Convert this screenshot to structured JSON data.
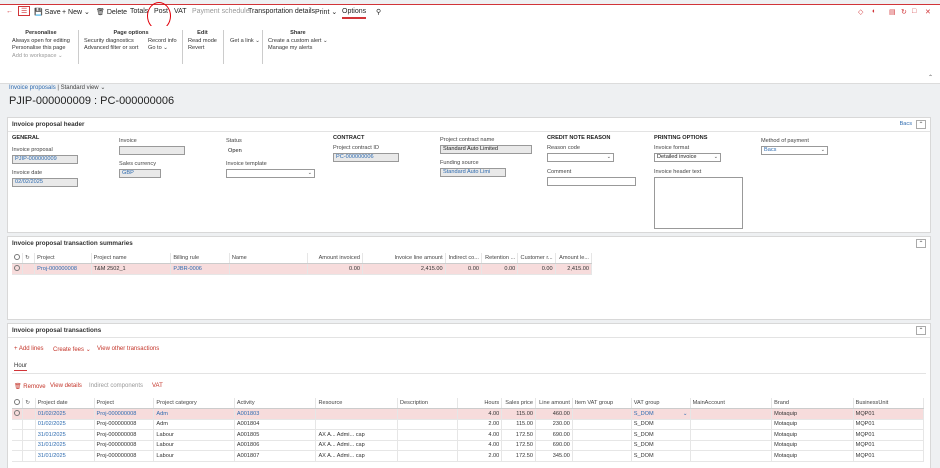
{
  "actionbar": {
    "save": "Save",
    "new": "New",
    "delete": "Delete",
    "totals": "Totals",
    "post": "Post",
    "vat": "VAT",
    "payment_schedule": "Payment schedule",
    "transportation": "Transportation details",
    "print": "Print",
    "options": "Options"
  },
  "ribbon": {
    "personalise": {
      "header": "Personalise",
      "items": [
        "Always open for editing",
        "Personalise this page",
        "Add to workspace"
      ]
    },
    "page_options": {
      "header": "Page options",
      "col1": [
        "Security diagnostics",
        "Advanced filter or sort"
      ],
      "col2": [
        "Record info",
        "Go to"
      ]
    },
    "edit": {
      "header": "Edit",
      "items": [
        "Read mode",
        "Revert"
      ]
    },
    "link": "Get a link",
    "share": {
      "header": "Share",
      "items": [
        "Create a custom alert",
        "Manage my alerts"
      ]
    }
  },
  "breadcrumb": {
    "link": "Invoice proposals",
    "sep": "|",
    "view": "Standard view"
  },
  "page_title": "PJIP-000000009 : PC-000000006",
  "header_panel": {
    "title": "Invoice proposal header",
    "bacs_link": "Bacs",
    "general": "GENERAL",
    "invoice_proposal_label": "Invoice proposal",
    "invoice_proposal": "PJIP-000000009",
    "invoice_date_label": "Invoice date",
    "invoice_date": "02/02/2025",
    "invoice_label": "Invoice",
    "invoice": "",
    "sales_currency_label": "Sales currency",
    "sales_currency": "GBP",
    "status_label": "Status",
    "status": "Open",
    "invoice_template_label": "Invoice template",
    "invoice_template": "",
    "contract": "CONTRACT",
    "contract_id_label": "Project contract ID",
    "contract_id": "PC-000000006",
    "contract_name_label": "Project contract name",
    "contract_name": "Standard Auto Limited",
    "funding_source_label": "Funding source",
    "funding_source": "Standard Auto Limi",
    "credit_note": "CREDIT NOTE REASON",
    "reason_code_label": "Reason code",
    "reason_code": "",
    "comment_label": "Comment",
    "comment": "",
    "printing": "PRINTING OPTIONS",
    "invoice_format_label": "Invoice format",
    "invoice_format": "Detailed invoice",
    "invoice_header_text_label": "Invoice header text",
    "method_payment_label": "Method of payment",
    "method_payment": "Bacs"
  },
  "summaries": {
    "title": "Invoice proposal transaction summaries",
    "columns": [
      "Project",
      "Project name",
      "Billing rule",
      "Name",
      "Amount invoiced",
      "Invoice line amount",
      "Indirect co...",
      "Retention ...",
      "Customer r...",
      "Amount le..."
    ],
    "rows": [
      [
        "Proj-000000008",
        "T&M 2502_1",
        "PJBR-0006",
        "",
        "0.00",
        "2,415.00",
        "0.00",
        "0.00",
        "0.00",
        "2,415.00"
      ]
    ]
  },
  "transactions": {
    "title": "Invoice proposal transactions",
    "toolbar": [
      "Add lines",
      "Create fees",
      "View other transactions"
    ],
    "tab": "Hour",
    "sub_toolbar": [
      "Remove",
      "View details",
      "Indirect components",
      "VAT"
    ],
    "columns": [
      "Project date",
      "Project",
      "Project category",
      "Activity",
      "Resource",
      "Description",
      "Hours",
      "Sales price",
      "Line amount",
      "Item VAT group",
      "VAT group",
      "MainAccount",
      "Brand",
      "BusinessUnit"
    ],
    "rows": [
      [
        "01/02/2025",
        "Proj-000000008",
        "Adm",
        "A001803",
        "",
        "",
        "4.00",
        "115.00",
        "460.00",
        "",
        "S_DOM",
        "",
        "Motaquip",
        "MQP01"
      ],
      [
        "01/02/2025",
        "Proj-000000008",
        "Adm",
        "A001804",
        "",
        "",
        "2.00",
        "115.00",
        "230.00",
        "",
        "S_DOM",
        "",
        "Motaquip",
        "MQP01"
      ],
      [
        "31/01/2025",
        "Proj-000000008",
        "Labour",
        "A001805",
        "AX A...  Admi...  cap",
        "",
        "4.00",
        "172.50",
        "690.00",
        "",
        "S_DOM",
        "",
        "Motaquip",
        "MQP01"
      ],
      [
        "31/01/2025",
        "Proj-000000008",
        "Labour",
        "A001806",
        "AX A...  Admi...  cap",
        "",
        "4.00",
        "172.50",
        "690.00",
        "",
        "S_DOM",
        "",
        "Motaquip",
        "MQP01"
      ],
      [
        "31/01/2025",
        "Proj-000000008",
        "Labour",
        "A001807",
        "AX A...  Admi...  cap",
        "",
        "2.00",
        "172.50",
        "345.00",
        "",
        "S_DOM",
        "",
        "Motaquip",
        "MQP01"
      ]
    ]
  }
}
